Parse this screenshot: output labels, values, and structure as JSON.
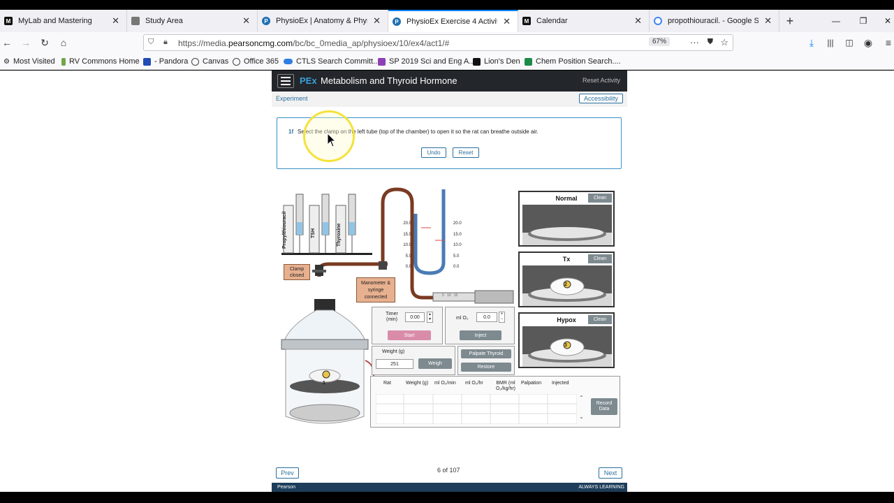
{
  "browser": {
    "tabs": [
      {
        "title": "MyLab and Mastering",
        "favicon": "mylab-icon",
        "active": false
      },
      {
        "title": "Study Area",
        "favicon": "page-icon",
        "active": false
      },
      {
        "title": "PhysioEx | Anatomy & Physiolo",
        "favicon": "physioex-icon",
        "active": false
      },
      {
        "title": "PhysioEx Exercise 4 Activity 1",
        "favicon": "physioex-icon",
        "active": true
      },
      {
        "title": "Calendar",
        "favicon": "calendar-icon",
        "active": false
      },
      {
        "title": "propothiouracil. - Google Sear",
        "favicon": "google-icon",
        "active": false
      }
    ],
    "url_prefix": "https://media.",
    "url_domain": "pearsoncmg.com",
    "url_suffix": "/bc/bc_0media_ap/physioex/10/ex4/act1/#",
    "zoom": "67%",
    "bookmarks": [
      "Most Visited",
      "RV Commons Home",
      "- Pandora",
      "Canvas",
      "Office 365",
      "CTLS Search Committ...",
      "SP 2019 Sci and Eng A...",
      "Lion's Den",
      "Chem Position Search...."
    ]
  },
  "app": {
    "logo": "PEx",
    "title": "Metabolism and Thyroid Hormone",
    "reset_activity": "Reset Activity",
    "section": "Experiment",
    "accessibility": "Accessibility",
    "step_number": "1f",
    "instruction": "Select the clamp on the left tube (top of the chamber) to open it so the rat can breathe outside air.",
    "undo": "Undo",
    "reset": "Reset"
  },
  "apparatus": {
    "syringes": [
      "Propylthiouracil",
      "TSH",
      "Thyroxine"
    ],
    "clamp_label": "Clamp closed",
    "manometer_label": "Manometer & syringe connected",
    "manometer_left_ticks": [
      "20.0",
      "15.0",
      "10.0",
      "5.0",
      "0.0"
    ],
    "manometer_right_ticks": [
      "20.0",
      "15.0",
      "10.0",
      "5.0",
      "0.0"
    ],
    "syringe_marks": [
      "5",
      "10",
      "15"
    ],
    "rat_numbers": [
      "1",
      "2",
      "3"
    ]
  },
  "controls": {
    "timer_label": "Timer (min)",
    "timer_value": "0:00",
    "start": "Start",
    "o2_label": "ml O₂",
    "o2_value": "0.0",
    "inject": "Inject",
    "weight_label": "Weight (g)",
    "weight_value": "251",
    "weigh": "Weigh",
    "palpate": "Palpate Thyroid",
    "restore": "Restore"
  },
  "chambers": [
    {
      "name": "Normal",
      "clean": "Clean"
    },
    {
      "name": "Tx",
      "clean": "Clean"
    },
    {
      "name": "Hypox",
      "clean": "Clean"
    }
  ],
  "table": {
    "columns": [
      "Rat",
      "Weight (g)",
      "ml O₂/min",
      "ml O₂/hr",
      "BMR (ml O₂/kg/hr)",
      "Palpation",
      "Injected"
    ],
    "record": "Record Data"
  },
  "nav": {
    "prev": "Prev",
    "next": "Next",
    "counter": "6 of 107"
  },
  "footer": {
    "left": "Pearson",
    "right": "ALWAYS LEARNING"
  }
}
